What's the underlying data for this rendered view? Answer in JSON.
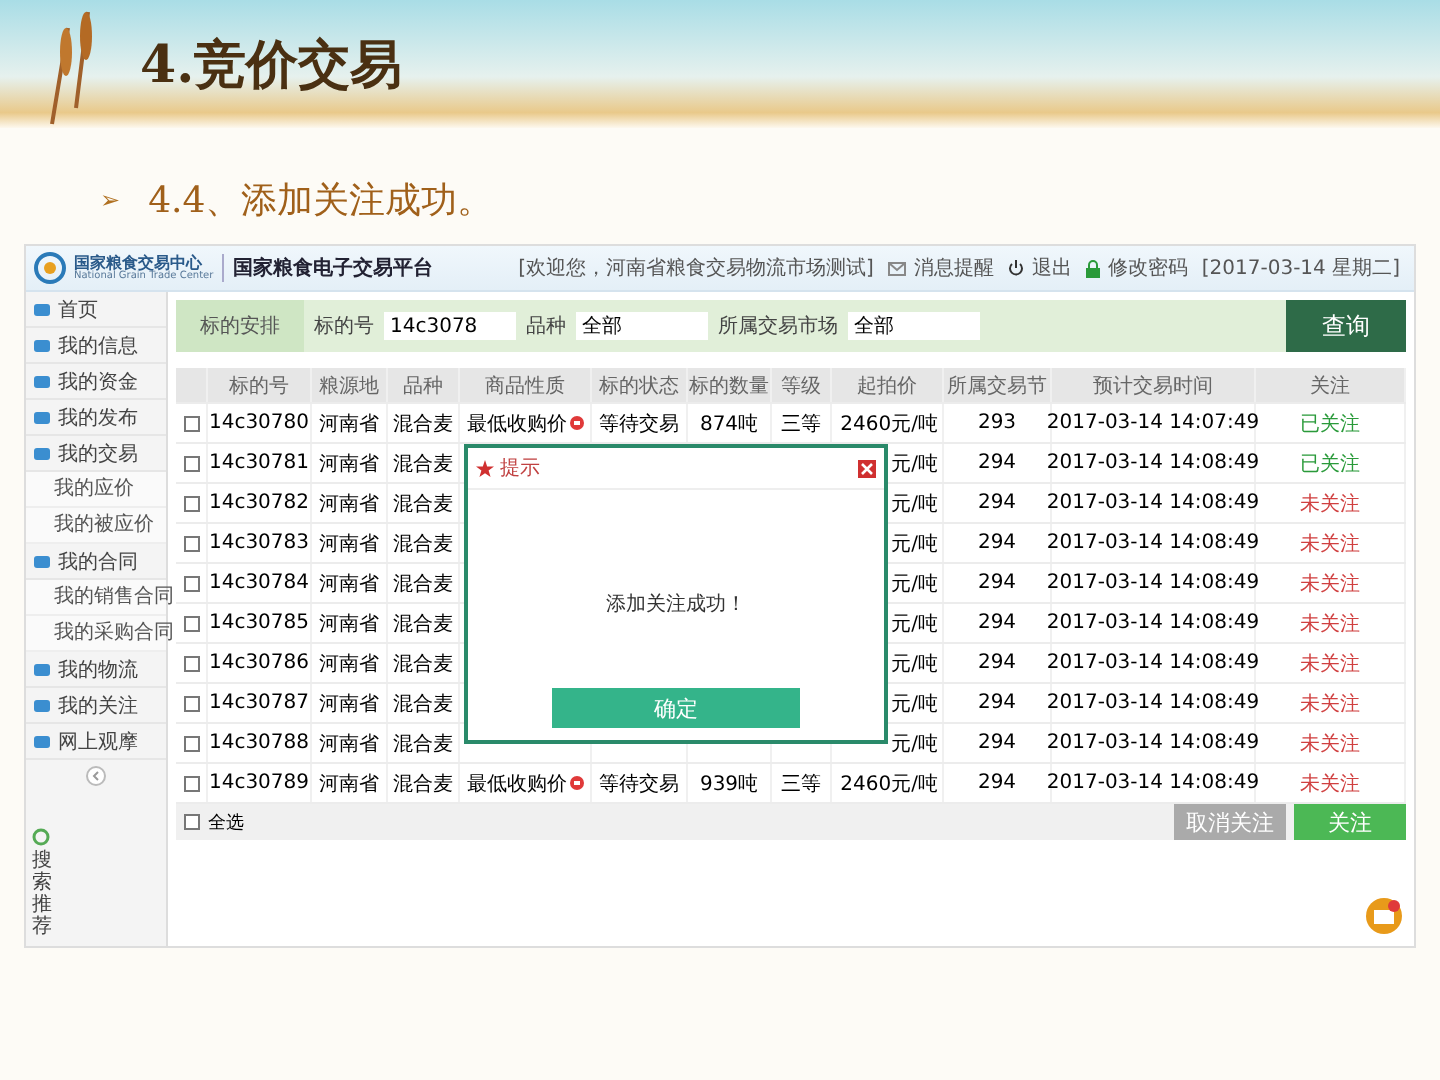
{
  "slide": {
    "title": "4.竞价交易",
    "subtitle_marker": "➢",
    "subtitle": "4.4、添加关注成功。"
  },
  "app": {
    "logo_cn": "国家粮食交易中心",
    "logo_en": "National Grain Trade Center",
    "platform": "国家粮食电子交易平台",
    "welcome": "[欢迎您，河南省粮食交易物流市场测试]",
    "messages": "消息提醒",
    "logout": "退出",
    "password": "修改密码",
    "date": "[2017-03-14 星期二]"
  },
  "sidebar": {
    "items": [
      {
        "label": "首页"
      },
      {
        "label": "我的信息"
      },
      {
        "label": "我的资金"
      },
      {
        "label": "我的发布"
      },
      {
        "label": "我的交易",
        "children": [
          {
            "label": "我的应价"
          },
          {
            "label": "我的被应价"
          }
        ]
      },
      {
        "label": "我的合同",
        "children": [
          {
            "label": "我的销售合同"
          },
          {
            "label": "我的采购合同"
          }
        ]
      },
      {
        "label": "我的物流"
      },
      {
        "label": "我的关注"
      },
      {
        "label": "网上观摩"
      }
    ],
    "bottom": "搜索推荐"
  },
  "search": {
    "section": "标的安排",
    "fields": [
      {
        "label": "标的号",
        "value": "14c3078"
      },
      {
        "label": "品种",
        "value": "全部"
      },
      {
        "label": "所属交易市场",
        "value": "全部"
      }
    ],
    "button": "查询"
  },
  "table": {
    "columns": [
      "标的号",
      "粮源地",
      "品种",
      "商品性质",
      "标的状态",
      "标的数量",
      "等级",
      "起拍价",
      "所属交易节",
      "预计交易时间",
      "关注"
    ],
    "rows": [
      {
        "checked": false,
        "code": "14c30780",
        "origin": "河南省",
        "variety": "混合麦",
        "nature": "最低收购价",
        "status": "等待交易",
        "quantity": "874吨",
        "grade": "三等",
        "price": "2460元/吨",
        "session": "293",
        "time": "2017-03-14 14:07:49",
        "follow": "已关注",
        "followed": true
      },
      {
        "checked": false,
        "code": "14c30781",
        "origin": "河南省",
        "variety": "混合麦",
        "price": "元/吨",
        "session": "294",
        "time": "2017-03-14 14:08:49",
        "follow": "已关注",
        "followed": true
      },
      {
        "checked": false,
        "code": "14c30782",
        "origin": "河南省",
        "variety": "混合麦",
        "price": "元/吨",
        "session": "294",
        "time": "2017-03-14 14:08:49",
        "follow": "未关注",
        "followed": false
      },
      {
        "checked": false,
        "code": "14c30783",
        "origin": "河南省",
        "variety": "混合麦",
        "price": "元/吨",
        "session": "294",
        "time": "2017-03-14 14:08:49",
        "follow": "未关注",
        "followed": false
      },
      {
        "checked": false,
        "code": "14c30784",
        "origin": "河南省",
        "variety": "混合麦",
        "price": "元/吨",
        "session": "294",
        "time": "2017-03-14 14:08:49",
        "follow": "未关注",
        "followed": false
      },
      {
        "checked": false,
        "code": "14c30785",
        "origin": "河南省",
        "variety": "混合麦",
        "price": "元/吨",
        "session": "294",
        "time": "2017-03-14 14:08:49",
        "follow": "未关注",
        "followed": false
      },
      {
        "checked": false,
        "code": "14c30786",
        "origin": "河南省",
        "variety": "混合麦",
        "price": "元/吨",
        "session": "294",
        "time": "2017-03-14 14:08:49",
        "follow": "未关注",
        "followed": false
      },
      {
        "checked": false,
        "code": "14c30787",
        "origin": "河南省",
        "variety": "混合麦",
        "price": "元/吨",
        "session": "294",
        "time": "2017-03-14 14:08:49",
        "follow": "未关注",
        "followed": false
      },
      {
        "checked": false,
        "code": "14c30788",
        "origin": "河南省",
        "variety": "混合麦",
        "price": "元/吨",
        "session": "294",
        "time": "2017-03-14 14:08:49",
        "follow": "未关注",
        "followed": false
      },
      {
        "checked": false,
        "code": "14c30789",
        "origin": "河南省",
        "variety": "混合麦",
        "nature": "最低收购价",
        "status": "等待交易",
        "quantity": "939吨",
        "grade": "三等",
        "price": "2460元/吨",
        "session": "294",
        "time": "2017-03-14 14:08:49",
        "follow": "未关注",
        "followed": false
      }
    ],
    "select_all": {
      "label": "全选",
      "checked": false
    },
    "buttons": [
      "取消关注",
      "关注"
    ]
  },
  "dialog": {
    "title": "提示",
    "message": "添加关注成功！",
    "button": "确定"
  }
}
